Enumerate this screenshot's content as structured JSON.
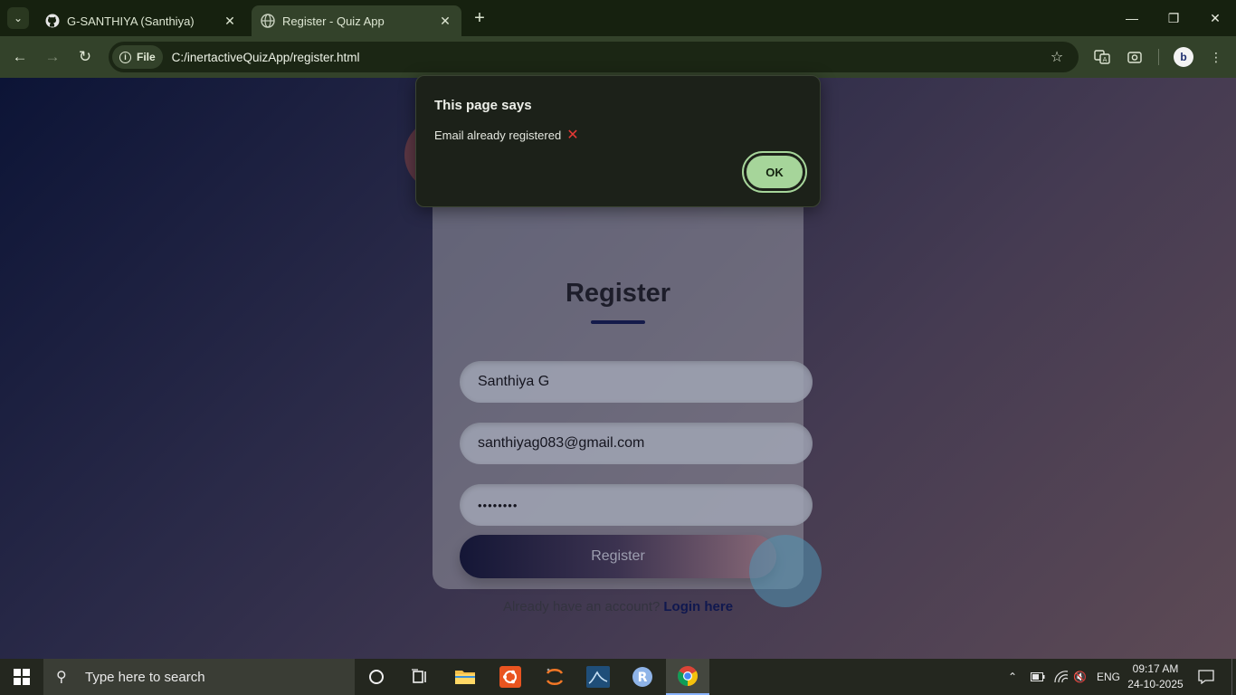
{
  "browser": {
    "tabs": [
      {
        "title": "G-SANTHIYA (Santhiya)",
        "icon": "github-icon",
        "active": false
      },
      {
        "title": "Register - Quiz App",
        "icon": "globe-icon",
        "active": true
      }
    ],
    "new_tab_label": "+",
    "address": {
      "chip_label": "File",
      "url": "C:/inertactiveQuizApp/register.html"
    },
    "profile_initial": "b"
  },
  "page": {
    "card_title": "Register",
    "fields": {
      "name_value": "Santhiya G",
      "email_value": "santhiyag083@gmail.com",
      "password_value": "••••••••"
    },
    "register_button": "Register",
    "account_prompt": "Already have an account?",
    "login_link": "Login here"
  },
  "dialog": {
    "title": "This page says",
    "message": "Email already registered",
    "message_icon": "red-cross-icon",
    "ok_label": "OK"
  },
  "taskbar": {
    "search_placeholder": "Type here to search",
    "language": "ENG",
    "time": "09:17 AM",
    "date": "24-10-2025",
    "apps": [
      "cortana-icon",
      "task-view-icon",
      "file-explorer-icon",
      "ubuntu-icon",
      "jupyter-icon",
      "mysql-workbench-icon",
      "r-icon",
      "chrome-icon"
    ]
  },
  "colors": {
    "accent_ok": "#a6d59a",
    "tab_strip": "#16210f",
    "toolbar": "#33422a"
  }
}
